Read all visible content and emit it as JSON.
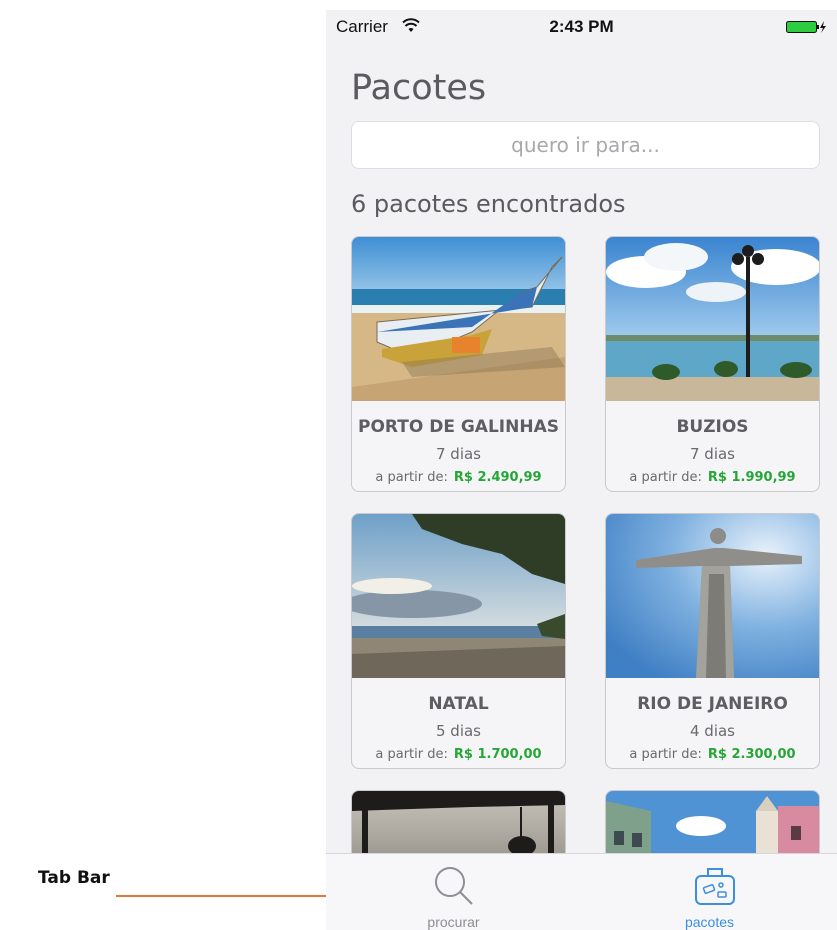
{
  "annotation": {
    "label": "Tab Bar",
    "arrow_color": "#e07a3c"
  },
  "status_bar": {
    "carrier": "Carrier",
    "time": "2:43 PM",
    "battery_color": "#2ecc40"
  },
  "header": {
    "title": "Pacotes"
  },
  "search": {
    "placeholder": "quero ir para..."
  },
  "results": {
    "count_text": "6 pacotes encontrados"
  },
  "price_prefix": "a partir de:",
  "packages": [
    {
      "name": "PORTO DE GALINHAS",
      "days": "7 dias",
      "price": "R$ 2.490,99"
    },
    {
      "name": "BUZIOS",
      "days": "7 dias",
      "price": "R$ 1.990,99"
    },
    {
      "name": "NATAL",
      "days": "5 dias",
      "price": "R$ 1.700,00"
    },
    {
      "name": "RIO DE JANEIRO",
      "days": "4 dias",
      "price": "R$ 2.300,00"
    }
  ],
  "tab_bar": {
    "tabs": [
      {
        "label": "procurar",
        "icon": "search-icon",
        "active": false
      },
      {
        "label": "pacotes",
        "icon": "suitcase-icon",
        "active": true
      }
    ],
    "active_color": "#3b8ee0",
    "inactive_color": "#8e8e93"
  }
}
